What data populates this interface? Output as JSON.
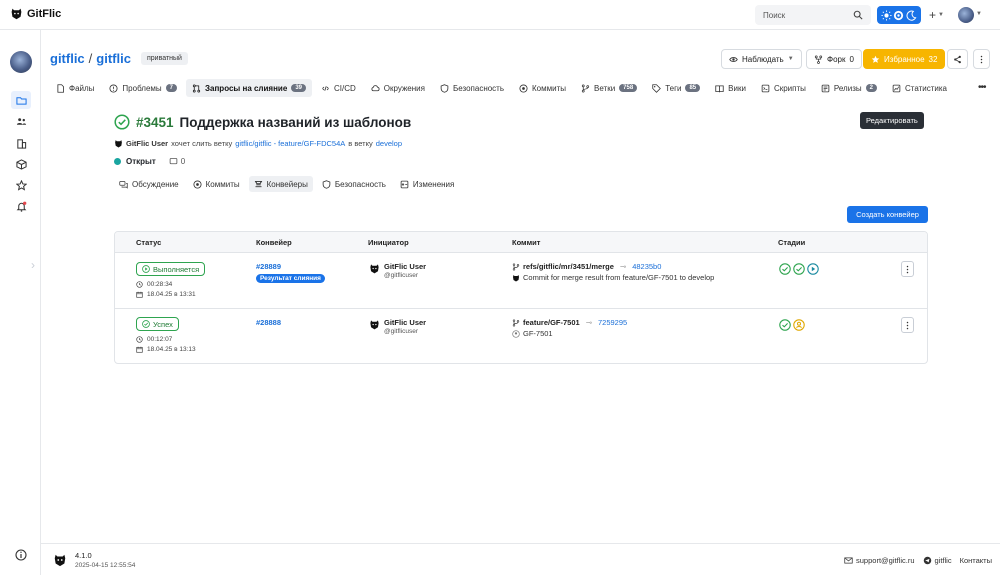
{
  "app": {
    "name": "GitFlic",
    "search_placeholder": "Поиск"
  },
  "repo": {
    "owner": "gitflic",
    "separator": "/",
    "name": "gitflic",
    "visibility": "приватный",
    "watch_label": "Наблюдать",
    "fork_label": "Форк",
    "fork_count": "0",
    "fav_label": "Избранное",
    "fav_count": "32"
  },
  "repo_tabs": [
    {
      "label": "Файлы",
      "icon": "file-icon"
    },
    {
      "label": "Проблемы",
      "icon": "issue-icon",
      "count": "7"
    },
    {
      "label": "Запросы на слияние",
      "icon": "merge-request-icon",
      "count": "39",
      "active": true
    },
    {
      "label": "CI/CD",
      "icon": "cicd-icon"
    },
    {
      "label": "Окружения",
      "icon": "cloud-icon"
    },
    {
      "label": "Безопасность",
      "icon": "shield-icon"
    },
    {
      "label": "Коммиты",
      "icon": "commit-icon"
    },
    {
      "label": "Ветки",
      "icon": "branch-icon",
      "count": "758"
    },
    {
      "label": "Теги",
      "icon": "tag-icon",
      "count": "85"
    },
    {
      "label": "Вики",
      "icon": "book-icon"
    },
    {
      "label": "Скрипты",
      "icon": "script-icon"
    },
    {
      "label": "Релизы",
      "icon": "release-icon",
      "count": "2"
    },
    {
      "label": "Статистика",
      "icon": "chart-icon"
    }
  ],
  "mr": {
    "number": "#3451",
    "title": "Поддержка названий из шаблонов",
    "edit_tooltip": "Редактировать",
    "author": "GitFlic User",
    "wants_merge": "хочет слить ветку",
    "source_branch": "gitflic/gitflic - feature/GF-FDC54A",
    "into": "в ветку",
    "target_branch": "develop",
    "status": "Открыт",
    "comments_count": "0"
  },
  "mr_tabs": [
    {
      "label": "Обсуждение",
      "icon": "discussion-icon"
    },
    {
      "label": "Коммиты",
      "icon": "commit-icon"
    },
    {
      "label": "Конвейеры",
      "icon": "pipeline-icon",
      "active": true
    },
    {
      "label": "Безопасность",
      "icon": "shield-icon"
    },
    {
      "label": "Изменения",
      "icon": "diff-icon"
    }
  ],
  "create_pipeline_label": "Создать конвейер",
  "table": {
    "headers": [
      "Статус",
      "Конвейер",
      "Инициатор",
      "Коммит",
      "Стадии"
    ],
    "rows": [
      {
        "status": "Выполняется",
        "duration": "00:28:34",
        "date": "18.04.25 в 13:31",
        "pipeline": "#28889",
        "badge": "Результат слияния",
        "initiator_name": "GitFlic User",
        "initiator_handle": "@gitflicuser",
        "ref": "refs/gitflic/mr/3451/merge",
        "hash": "48235b0",
        "message": "Commit for merge result from feature/GF-7501 to develop",
        "stages": [
          "success",
          "success",
          "running"
        ]
      },
      {
        "status": "Успех",
        "duration": "00:12:07",
        "date": "18.04.25 в 13:13",
        "pipeline": "#28888",
        "initiator_name": "GitFlic User",
        "initiator_handle": "@gitflicuser",
        "ref": "feature/GF-7501",
        "hash": "7259295",
        "message": "GF-7501",
        "stages": [
          "success",
          "manual"
        ]
      }
    ]
  },
  "footer": {
    "version": "4.1.0",
    "build_date": "2025-04-15 12:55:54",
    "email": "support@gitflic.ru",
    "telegram": "gitflic",
    "contacts": "Контакты"
  },
  "colors": {
    "accent": "#1a73e8",
    "success": "#2ea44f",
    "favorite": "#f7b500",
    "open_status": "#1aa5a0"
  }
}
